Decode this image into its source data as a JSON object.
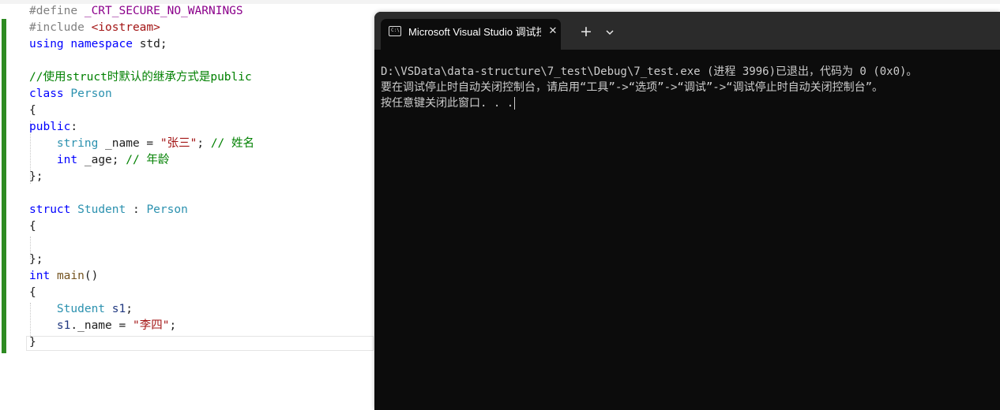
{
  "editor": {
    "lines": [
      [
        {
          "t": "#define ",
          "c": "pp"
        },
        {
          "t": "_CRT_SECURE_NO_WARNINGS",
          "c": "macro"
        }
      ],
      [
        {
          "t": "#include ",
          "c": "pp"
        },
        {
          "t": "<iostream>",
          "c": "str"
        }
      ],
      [
        {
          "t": "using",
          "c": "kw"
        },
        {
          "t": " ",
          "c": "plain"
        },
        {
          "t": "namespace",
          "c": "kw"
        },
        {
          "t": " std;",
          "c": "plain"
        }
      ],
      [],
      [
        {
          "t": "//使用struct时默认的继承方式是public",
          "c": "cmt"
        }
      ],
      [
        {
          "t": "class",
          "c": "kw"
        },
        {
          "t": " ",
          "c": "plain"
        },
        {
          "t": "Person",
          "c": "type"
        }
      ],
      [
        {
          "t": "{",
          "c": "plain"
        }
      ],
      [
        {
          "t": "public",
          "c": "kw"
        },
        {
          "t": ":",
          "c": "plain"
        }
      ],
      [
        {
          "t": "    ",
          "c": "plain"
        },
        {
          "t": "string",
          "c": "type"
        },
        {
          "t": " _name = ",
          "c": "plain"
        },
        {
          "t": "\"张三\"",
          "c": "str"
        },
        {
          "t": "; ",
          "c": "plain"
        },
        {
          "t": "// 姓名",
          "c": "cmt"
        }
      ],
      [
        {
          "t": "    ",
          "c": "plain"
        },
        {
          "t": "int",
          "c": "kw"
        },
        {
          "t": " _age; ",
          "c": "plain"
        },
        {
          "t": "// 年龄",
          "c": "cmt"
        }
      ],
      [
        {
          "t": "};",
          "c": "plain"
        }
      ],
      [],
      [
        {
          "t": "struct",
          "c": "kw"
        },
        {
          "t": " ",
          "c": "plain"
        },
        {
          "t": "Student",
          "c": "type"
        },
        {
          "t": " : ",
          "c": "plain"
        },
        {
          "t": "Person",
          "c": "type"
        }
      ],
      [
        {
          "t": "{",
          "c": "plain"
        }
      ],
      [],
      [
        {
          "t": "};",
          "c": "plain"
        }
      ],
      [
        {
          "t": "int",
          "c": "kw"
        },
        {
          "t": " ",
          "c": "plain"
        },
        {
          "t": "main",
          "c": "fn"
        },
        {
          "t": "()",
          "c": "plain"
        }
      ],
      [
        {
          "t": "{",
          "c": "plain"
        }
      ],
      [
        {
          "t": "    ",
          "c": "plain"
        },
        {
          "t": "Student",
          "c": "type"
        },
        {
          "t": " ",
          "c": "plain"
        },
        {
          "t": "s1",
          "c": "var"
        },
        {
          "t": ";",
          "c": "plain"
        }
      ],
      [
        {
          "t": "    ",
          "c": "plain"
        },
        {
          "t": "s1",
          "c": "var"
        },
        {
          "t": "._name = ",
          "c": "plain"
        },
        {
          "t": "\"李四\"",
          "c": "str"
        },
        {
          "t": ";",
          "c": "plain"
        }
      ],
      [
        {
          "t": "}",
          "c": "plain"
        }
      ]
    ]
  },
  "terminal": {
    "tab_title": "Microsoft Visual Studio 调试控制台",
    "tab_icon_text": "C:\\",
    "tab_icon": "terminal-icon",
    "close_glyph": "✕",
    "new_tab_glyph": "+",
    "dropdown_icon": "chevron-down-icon",
    "output": {
      "line1": "D:\\VSData\\data-structure\\7_test\\Debug\\7_test.exe (进程 3996)已退出，代码为 0 (0x0)。",
      "line2": "要在调试停止时自动关闭控制台，请启用“工具”->“选项”->“调试”->“调试停止时自动关闭控制台”。",
      "line3": "按任意键关闭此窗口. . ."
    }
  },
  "colors": {
    "editor_bg": "#ffffff",
    "change_bar": "#2e8b22",
    "terminal_bg": "#0c0c0c",
    "titlebar_bg": "#2b2b2b",
    "console_text": "#cccccc"
  }
}
